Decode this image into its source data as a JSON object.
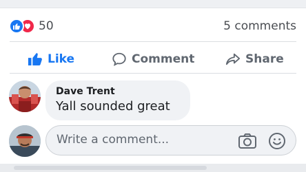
{
  "reactions": {
    "icons": [
      "like-icon",
      "love-icon"
    ],
    "count": "50",
    "comments_label": "5 comments"
  },
  "actions": {
    "like_label": "Like",
    "comment_label": "Comment",
    "share_label": "Share"
  },
  "comment": {
    "author": "Dave Trent",
    "text": "Yall sounded great"
  },
  "composer": {
    "placeholder": "Write a comment..."
  },
  "colors": {
    "like_blue": "#1877f2",
    "love_red": "#f0284a",
    "bubble_bg": "#f0f2f5",
    "muted_text": "#606770"
  }
}
